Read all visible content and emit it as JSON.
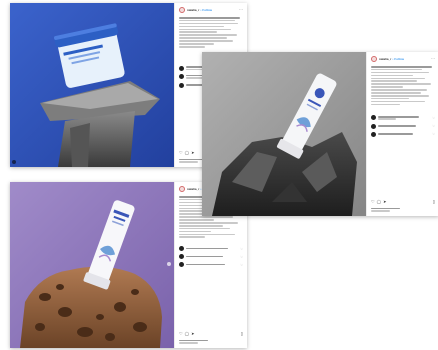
{
  "posts": [
    {
      "account": "natalia_r",
      "follow": "Follow",
      "product_jar_label": "HYDRO",
      "icons": [
        "more-icon",
        "heart-icon",
        "comment-icon",
        "share-icon",
        "bookmark-icon"
      ]
    },
    {
      "account": "natalia_r",
      "follow": "Follow",
      "product_tube_label": "HYDRO",
      "icons": [
        "more-icon",
        "heart-icon",
        "comment-icon",
        "share-icon",
        "bookmark-icon"
      ]
    },
    {
      "account": "natalia_r",
      "follow": "Follow",
      "product_tube_label": "HYDRO",
      "icons": [
        "more-icon",
        "heart-icon",
        "comment-icon",
        "share-icon",
        "bookmark-icon"
      ]
    }
  ],
  "colors": {
    "blue_bg": "#2f52b8",
    "grey_bg": "#9c9c9c",
    "purple_bg": "#8c74b8",
    "follow": "#3897f0"
  }
}
